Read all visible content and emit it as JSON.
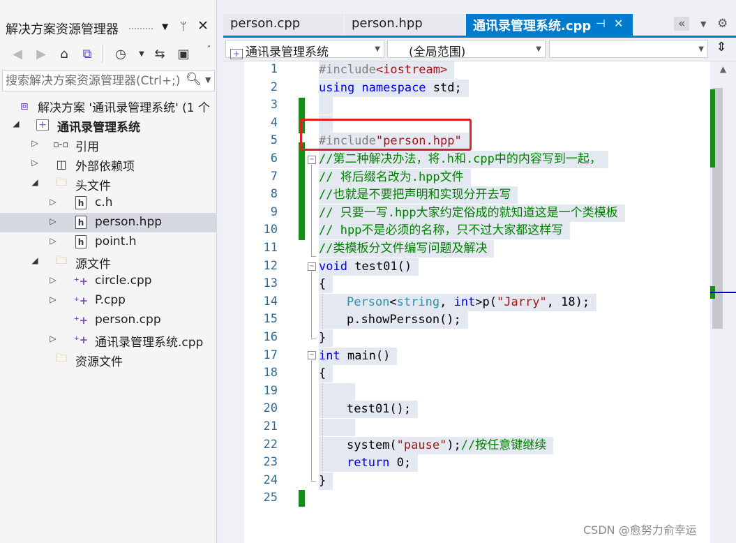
{
  "solution_explorer": {
    "title": "解决方案资源管理器",
    "search_placeholder": "搜索解决方案资源管理器(Ctrl+;)",
    "tree": [
      {
        "label": "解决方案 '通讯录管理系统' (1 个",
        "kind": "solution"
      },
      {
        "label": "通讯录管理系统",
        "kind": "project"
      },
      {
        "label": "引用",
        "kind": "references"
      },
      {
        "label": "外部依赖项",
        "kind": "external"
      },
      {
        "label": "头文件",
        "kind": "folder"
      },
      {
        "label": "c.h",
        "kind": "header"
      },
      {
        "label": "person.hpp",
        "kind": "header"
      },
      {
        "label": "point.h",
        "kind": "header"
      },
      {
        "label": "源文件",
        "kind": "folder"
      },
      {
        "label": "circle.cpp",
        "kind": "cpp"
      },
      {
        "label": "P.cpp",
        "kind": "cpp"
      },
      {
        "label": "person.cpp",
        "kind": "cpp"
      },
      {
        "label": "通讯录管理系统.cpp",
        "kind": "cpp"
      },
      {
        "label": "资源文件",
        "kind": "folder"
      }
    ]
  },
  "tabs": [
    "person.cpp",
    "person.hpp",
    "通讯录管理系统.cpp"
  ],
  "navbar": {
    "project": "通讯录管理系统",
    "scope": "(全局范围)",
    "member": ""
  },
  "code_lines": [
    {
      "n": "1"
    },
    {
      "n": "2"
    },
    {
      "n": "3"
    },
    {
      "n": "4"
    },
    {
      "n": "5"
    },
    {
      "n": "6"
    },
    {
      "n": "7"
    },
    {
      "n": "8"
    },
    {
      "n": "9"
    },
    {
      "n": "10"
    },
    {
      "n": "11"
    },
    {
      "n": "12"
    },
    {
      "n": "13"
    },
    {
      "n": "14"
    },
    {
      "n": "15"
    },
    {
      "n": "16"
    },
    {
      "n": "17"
    },
    {
      "n": "18"
    },
    {
      "n": "19"
    },
    {
      "n": "20"
    },
    {
      "n": "21"
    },
    {
      "n": "22"
    },
    {
      "n": "23"
    },
    {
      "n": "24"
    },
    {
      "n": "25"
    }
  ],
  "code": {
    "l1_a": "#include",
    "l1_b": "<iostream>",
    "l2_a": "using",
    "l2_b": " namespace",
    "l2_c": " std;",
    "l5_a": "#include",
    "l5_b": "\"person.hpp\"",
    "l6": "//第二种解决办法，将.h和.cpp中的内容写到一起，",
    "l7": "// 将后缀名改为.hpp文件",
    "l8": "//也就是不要把声明和实现分开去写",
    "l9": "// 只要一写.hpp大家约定俗成的就知道这是一个类模板",
    "l10": "// hpp不是必须的名称，只不过大家都这样写",
    "l11": "//类模板分文件编写问题及解决",
    "l12_a": "void",
    "l12_b": " test01()",
    "l13": "{",
    "l14_a": "Person",
    "l14_b": "<",
    "l14_c": "string",
    "l14_d": ", ",
    "l14_e": "int",
    "l14_f": ">p(",
    "l14_g": "\"Jarry\"",
    "l14_h": ", 18);",
    "l15": "p.showPersson();",
    "l16": "}",
    "l17_a": "int",
    "l17_b": " main()",
    "l18": "{",
    "l20": "test01();",
    "l22_a": "system(",
    "l22_b": "\"pause\"",
    "l22_c": ");",
    "l22_d": "//按任意键继续",
    "l23_a": "return",
    "l23_b": " 0;",
    "l24": "}"
  },
  "watermark": "CSDN @愈努力俞幸运"
}
